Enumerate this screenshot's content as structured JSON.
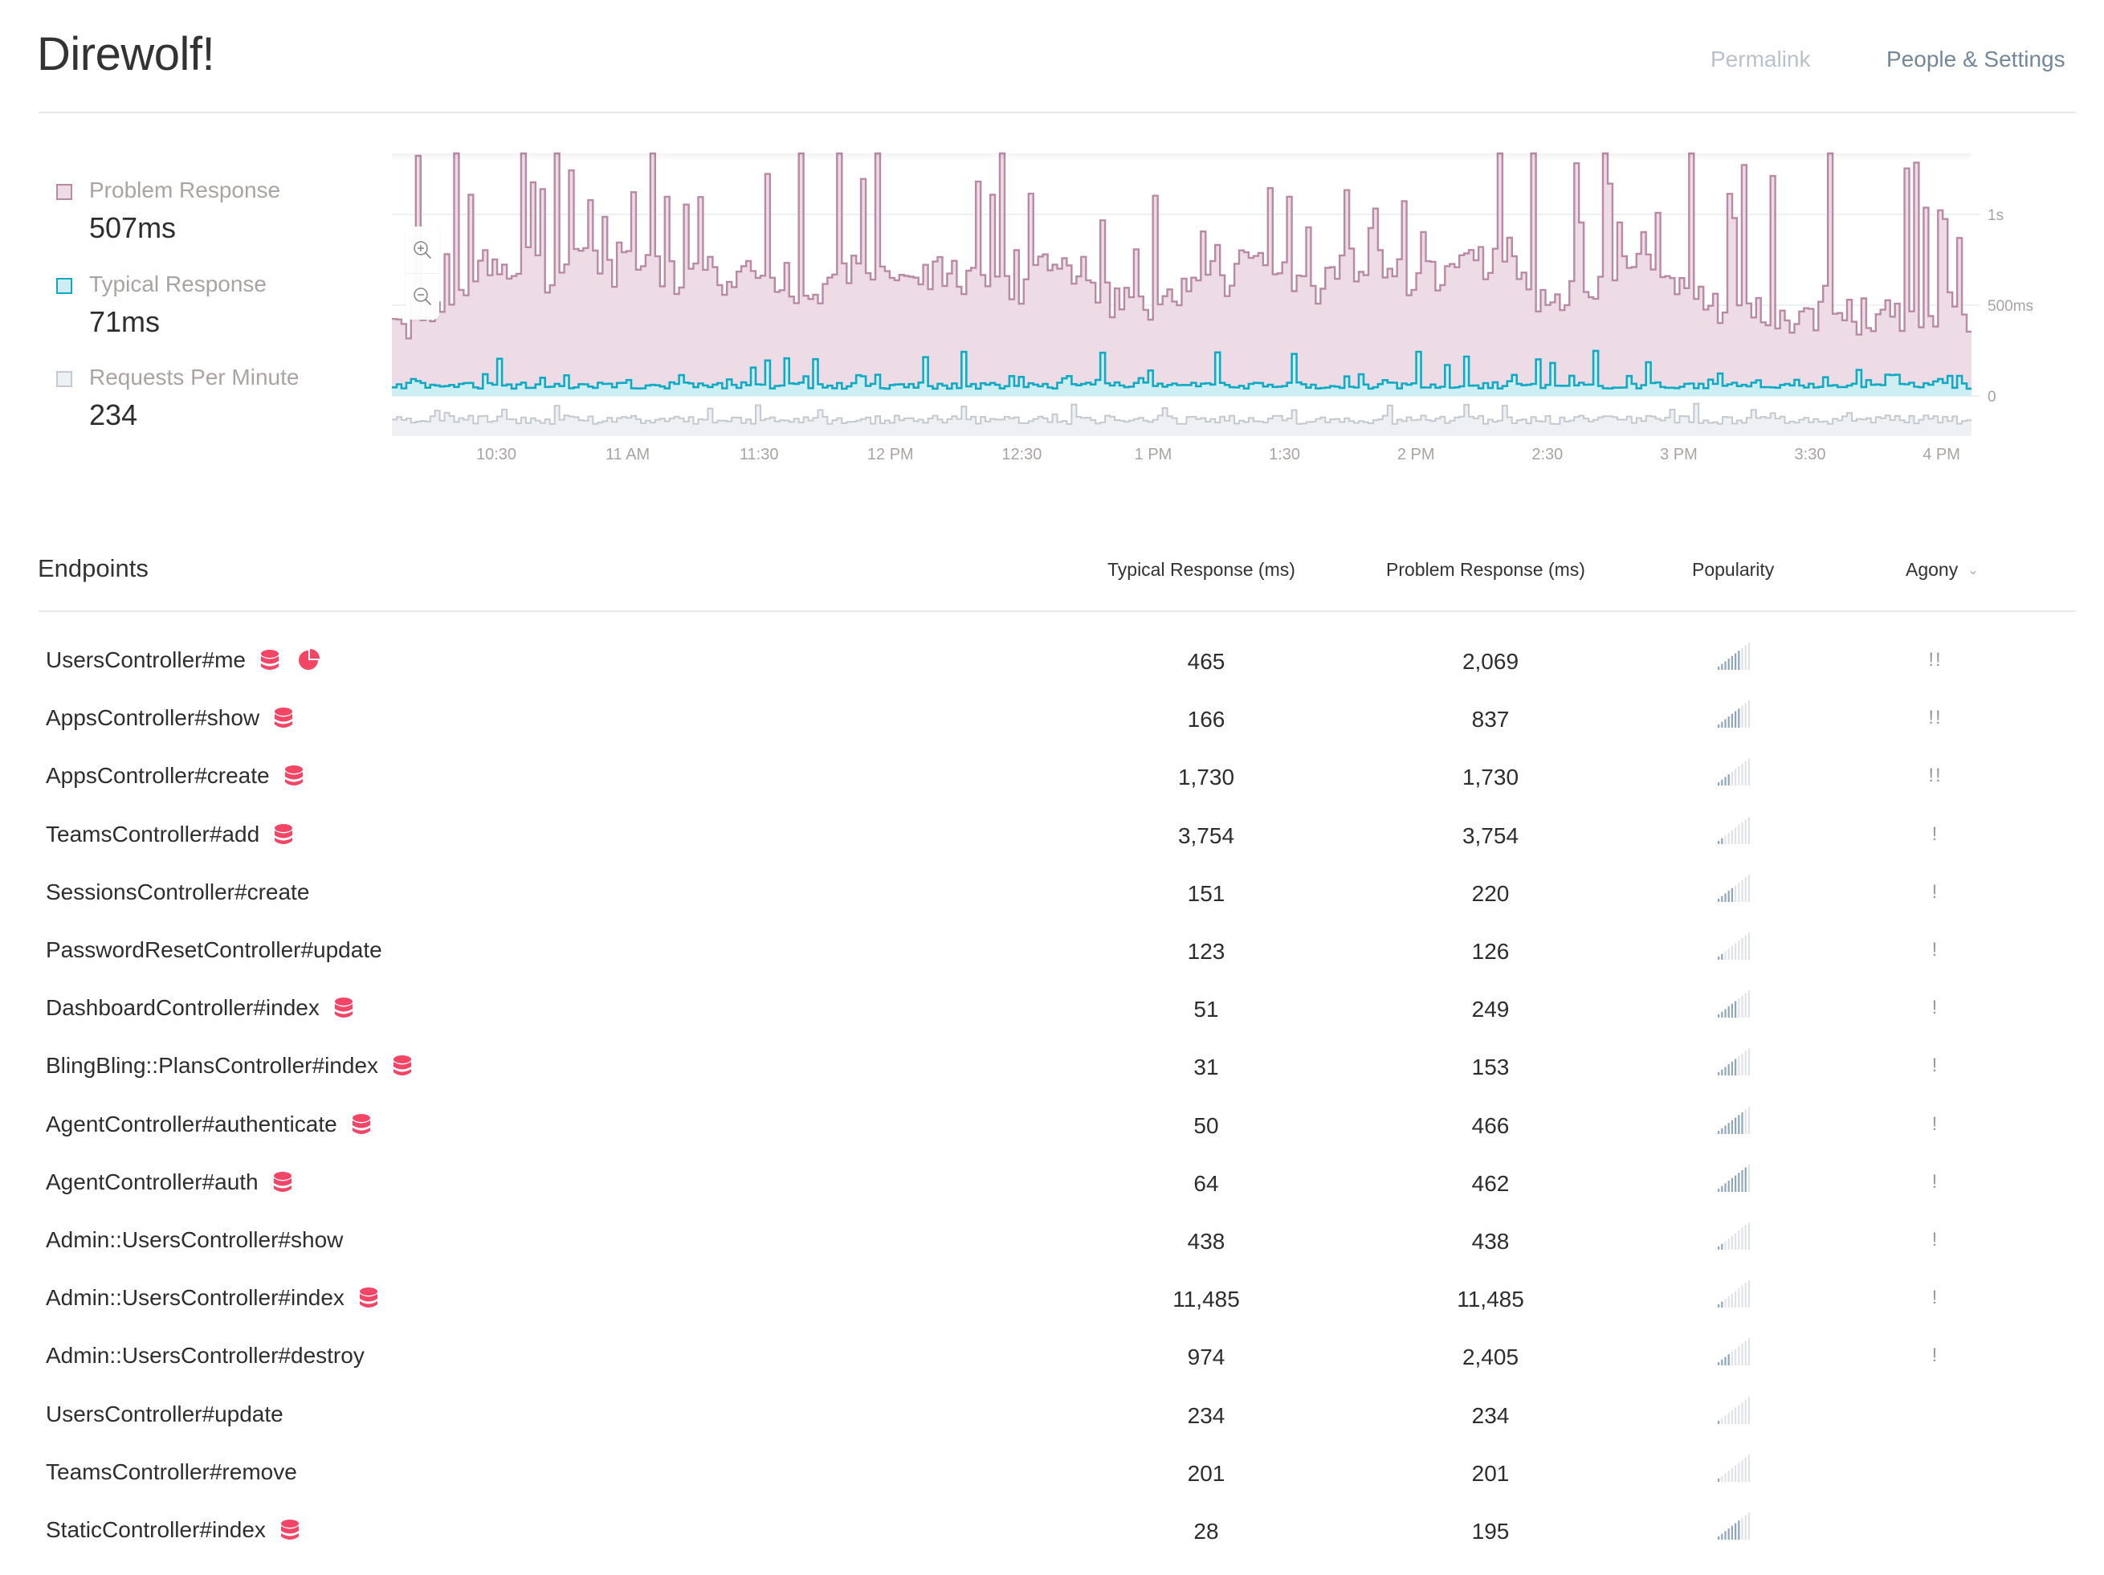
{
  "header": {
    "title": "Direwolf!",
    "links": [
      {
        "label": "Permalink",
        "color": "#b8c2cc"
      },
      {
        "label": "People & Settings",
        "color": "#73879b"
      }
    ]
  },
  "legend": [
    {
      "label": "Problem Response",
      "value": "507ms",
      "swatch_fill": "#eddbe6",
      "swatch_border": "#b88aa4"
    },
    {
      "label": "Typical Response",
      "value": "71ms",
      "swatch_fill": "#cdeef3",
      "swatch_border": "#12a9c3"
    },
    {
      "label": "Requests Per Minute",
      "value": "234",
      "swatch_fill": "#eef1f4",
      "swatch_border": "#c3c9ce"
    }
  ],
  "zoom_controls": {
    "zoom_in": "zoom-in-icon",
    "zoom_out": "zoom-out-icon"
  },
  "chart_data": {
    "type": "area",
    "title": "",
    "xlabel": "",
    "ylabel": "",
    "x_ticks": [
      "10:30",
      "11 AM",
      "11:30",
      "12 PM",
      "12:30",
      "1 PM",
      "1:30",
      "2 PM",
      "2:30",
      "3 PM",
      "3:30",
      "4 PM"
    ],
    "x_range": [
      "~10:06",
      "~4:07 PM"
    ],
    "y_ticks": [
      "0",
      "500ms",
      "1s"
    ],
    "y_tick_values_ms": [
      0,
      500,
      1000
    ],
    "ylim_ms": [
      0,
      1330
    ],
    "grid": true,
    "step": true,
    "colors": {
      "problem_line": "#b88aa4",
      "problem_fill": "#eddbe6",
      "typical_line": "#12a9c3",
      "typical_fill": "#cdeef3",
      "requests_line": "#c3c9ce",
      "requests_fill": "#eef1f4"
    },
    "series": [
      {
        "name": "Problem Response",
        "unit": "ms",
        "summary": 507,
        "description": "spiky step series, mostly 250–700ms with frequent spikes above 1s"
      },
      {
        "name": "Typical Response",
        "unit": "ms",
        "summary": 71,
        "description": "step series mostly 30–80ms, occasional spikes to ~250ms"
      },
      {
        "name": "Requests Per Minute",
        "unit": "rpm",
        "summary": 234,
        "description": "sparkline band below main chart, low variation with occasional spikes"
      }
    ],
    "series_generation_seed": 7
  },
  "table": {
    "title": "Endpoints",
    "columns": [
      "Typical Response (ms)",
      "Problem Response (ms)",
      "Popularity",
      "Agony"
    ],
    "sort_indicator": "⌄",
    "icon_color": "#f34565",
    "pop_on_color": "#8ea6bb",
    "pop_off_color": "#dfe3e8",
    "rows": [
      {
        "name": "UsersController#me",
        "icons": [
          "database-icon",
          "pie-chart-icon"
        ],
        "typical": "465",
        "problem": "2,069",
        "popularity": 7,
        "agony": "!!"
      },
      {
        "name": "AppsController#show",
        "icons": [
          "database-icon"
        ],
        "typical": "166",
        "problem": "837",
        "popularity": 7,
        "agony": "!!"
      },
      {
        "name": "AppsController#create",
        "icons": [
          "database-icon"
        ],
        "typical": "1,730",
        "problem": "1,730",
        "popularity": 4,
        "agony": "!!"
      },
      {
        "name": "TeamsController#add",
        "icons": [
          "database-icon"
        ],
        "typical": "3,754",
        "problem": "3,754",
        "popularity": 2,
        "agony": "!"
      },
      {
        "name": "SessionsController#create",
        "icons": [],
        "typical": "151",
        "problem": "220",
        "popularity": 5,
        "agony": "!"
      },
      {
        "name": "PasswordResetController#update",
        "icons": [],
        "typical": "123",
        "problem": "126",
        "popularity": 2,
        "agony": "!"
      },
      {
        "name": "DashboardController#index",
        "icons": [
          "database-icon"
        ],
        "typical": "51",
        "problem": "249",
        "popularity": 6,
        "agony": "!"
      },
      {
        "name": "BlingBling::PlansController#index",
        "icons": [
          "database-icon"
        ],
        "typical": "31",
        "problem": "153",
        "popularity": 6,
        "agony": "!"
      },
      {
        "name": "AgentController#authenticate",
        "icons": [
          "database-icon"
        ],
        "typical": "50",
        "problem": "466",
        "popularity": 8,
        "agony": "!"
      },
      {
        "name": "AgentController#auth",
        "icons": [
          "database-icon"
        ],
        "typical": "64",
        "problem": "462",
        "popularity": 9,
        "agony": "!"
      },
      {
        "name": "Admin::UsersController#show",
        "icons": [],
        "typical": "438",
        "problem": "438",
        "popularity": 2,
        "agony": "!"
      },
      {
        "name": "Admin::UsersController#index",
        "icons": [
          "database-icon"
        ],
        "typical": "11,485",
        "problem": "11,485",
        "popularity": 2,
        "agony": "!"
      },
      {
        "name": "Admin::UsersController#destroy",
        "icons": [],
        "typical": "974",
        "problem": "2,405",
        "popularity": 4,
        "agony": "!"
      },
      {
        "name": "UsersController#update",
        "icons": [],
        "typical": "234",
        "problem": "234",
        "popularity": 1,
        "agony": ""
      },
      {
        "name": "TeamsController#remove",
        "icons": [],
        "typical": "201",
        "problem": "201",
        "popularity": 1,
        "agony": ""
      },
      {
        "name": "StaticController#index",
        "icons": [
          "database-icon"
        ],
        "typical": "28",
        "problem": "195",
        "popularity": 7,
        "agony": ""
      }
    ]
  }
}
